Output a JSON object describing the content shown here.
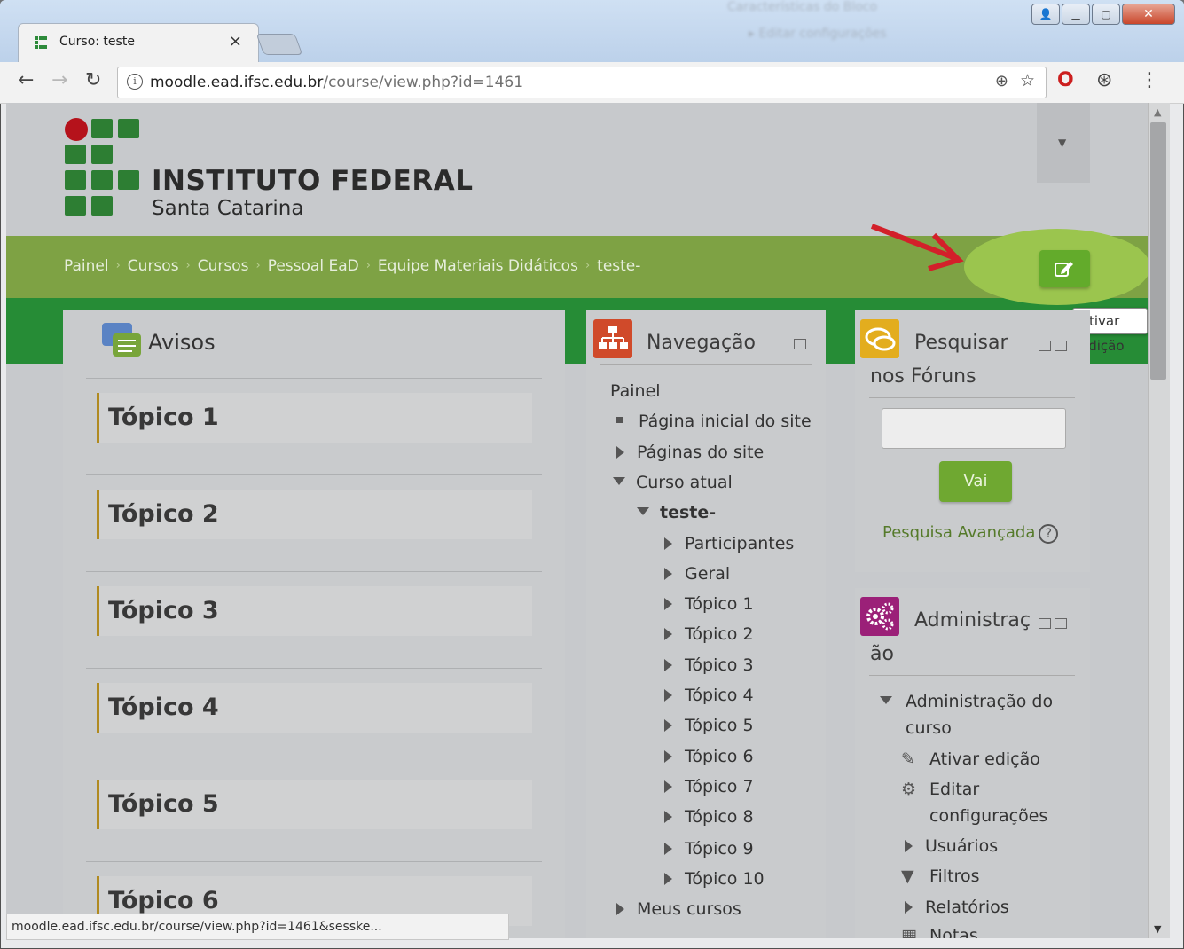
{
  "browser": {
    "tab_title": "Curso: teste",
    "tab_close": "×",
    "url_host": "moodle.ead.ifsc.edu.br",
    "url_path": "/course/view.php?id=1461",
    "status_url": "moodle.ead.ifsc.edu.br/course/view.php?id=1461&sesske..."
  },
  "background_window": {
    "line1": "Características do Bloco",
    "line2": "▸ Editar configurações"
  },
  "site": {
    "brand_line1": "INSTITUTO FEDERAL",
    "brand_line2": "Santa Catarina"
  },
  "breadcrumb": [
    "Painel",
    "Cursos",
    "Cursos",
    "Pessoal EaD",
    "Equipe Materiais Didáticos",
    "teste-"
  ],
  "edit_tooltip": "Ativar edição",
  "avisos": {
    "title": "Avisos",
    "topics": [
      "Tópico 1",
      "Tópico 2",
      "Tópico 3",
      "Tópico 4",
      "Tópico 5",
      "Tópico 6"
    ]
  },
  "navegacao": {
    "title": "Navegação",
    "painel": "Painel",
    "home": "Página inicial do site",
    "pages": "Páginas do site",
    "curso_atual": "Curso atual",
    "course": "teste-",
    "participants": "Participantes",
    "geral": "Geral",
    "topics": [
      "Tópico 1",
      "Tópico 2",
      "Tópico 3",
      "Tópico 4",
      "Tópico 5",
      "Tópico 6",
      "Tópico 7",
      "Tópico 8",
      "Tópico 9",
      "Tópico 10"
    ],
    "meus_cursos": "Meus cursos"
  },
  "forum_search": {
    "title_line1": "Pesquisar",
    "title_line2": "nos Fóruns",
    "button": "Vai",
    "advanced": "Pesquisa Avançada",
    "help": "?"
  },
  "admin": {
    "title_line1": "Administraç",
    "title_line2": "ão",
    "course_admin_line1": "Administração do",
    "course_admin_line2": "curso",
    "edit_on": "Ativar edição",
    "edit_settings_line1": "Editar",
    "edit_settings_line2": "configurações",
    "users": "Usuários",
    "filters": "Filtros",
    "reports": "Relatórios",
    "grades": "Notas"
  }
}
